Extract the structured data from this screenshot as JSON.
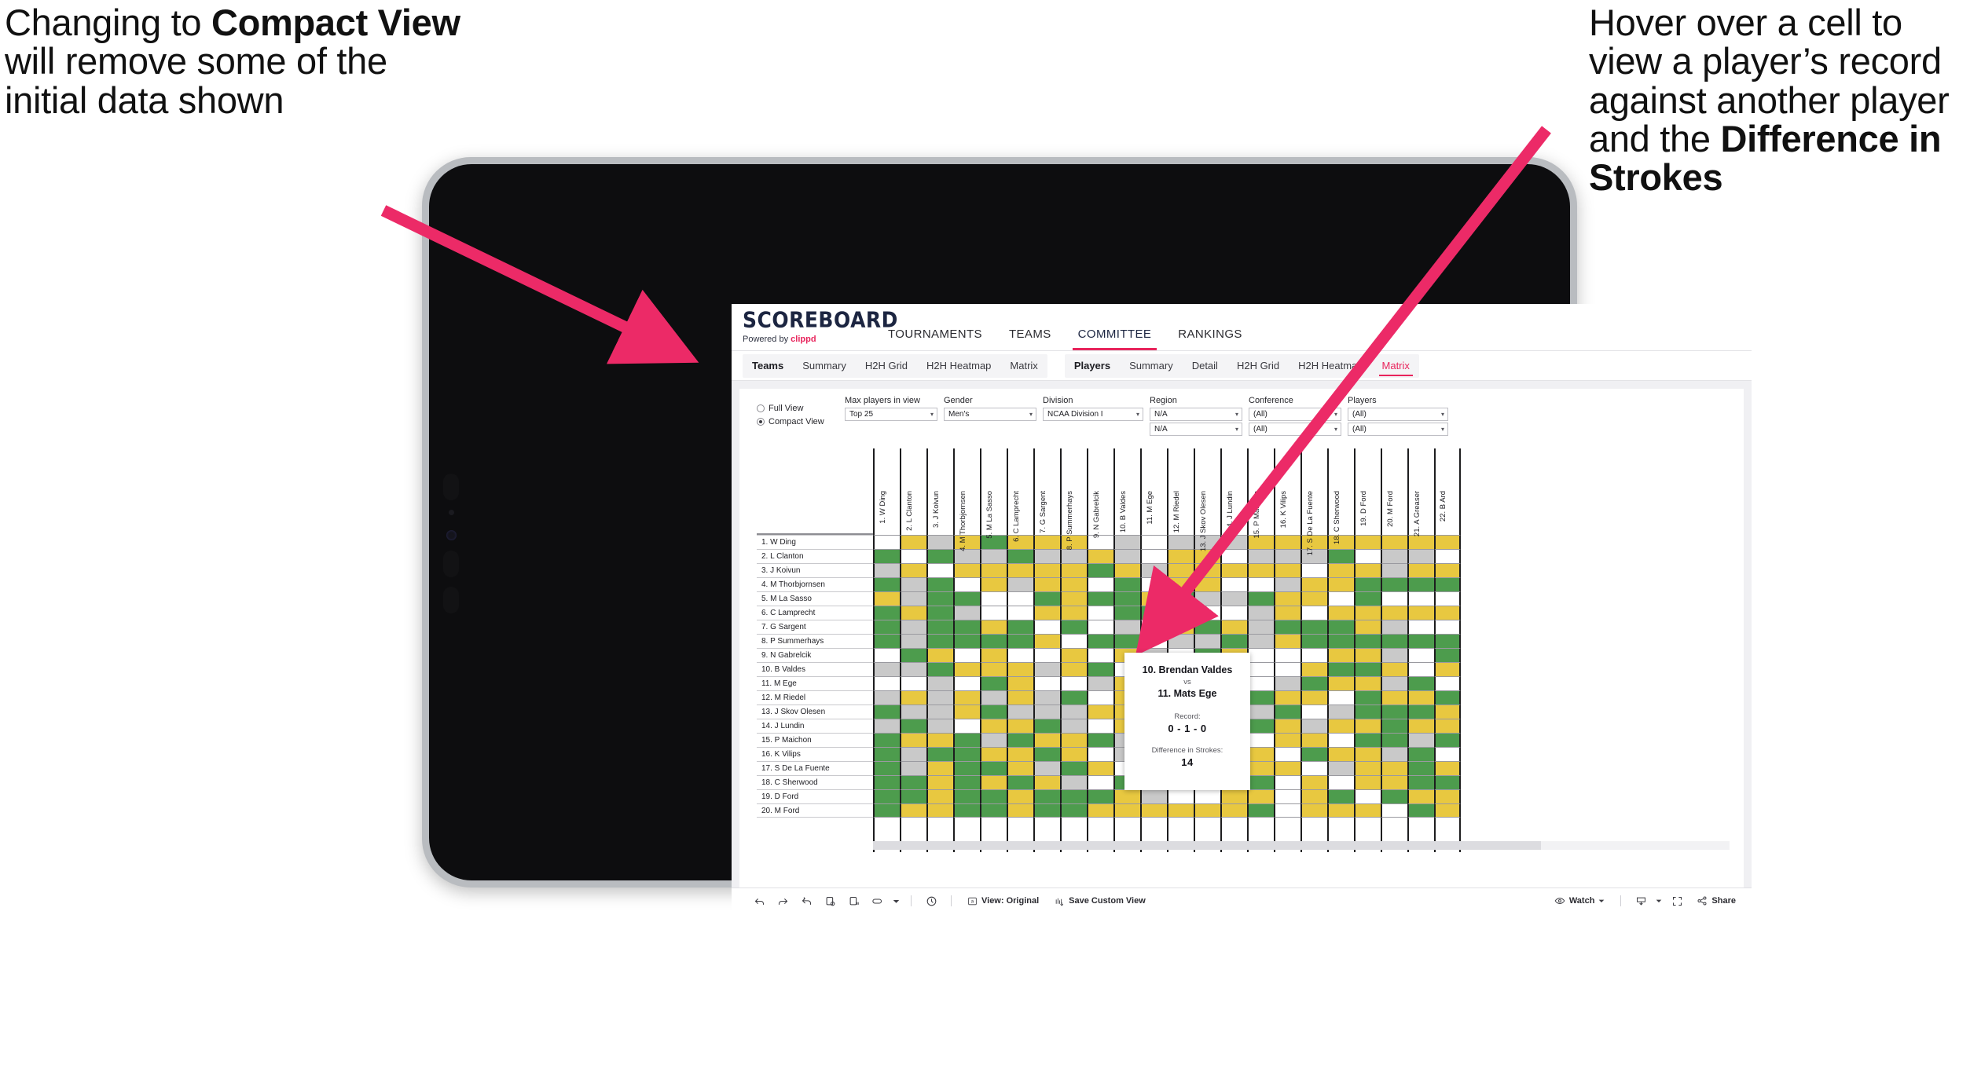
{
  "annotations": {
    "left": {
      "line1": "Changing to ",
      "bold": "Compact View",
      "line2": " will remove some of the initial data shown"
    },
    "right": {
      "line1": "Hover over a cell to view a player’s record against another player and the ",
      "bold": "Difference in Strokes"
    }
  },
  "accent_color": "#e8245c",
  "app": {
    "logo": {
      "word": "SCOREBOARD",
      "powered_prefix": "Powered by ",
      "brand": "clippd"
    },
    "top_nav": [
      {
        "label": "TOURNAMENTS",
        "active": false
      },
      {
        "label": "TEAMS",
        "active": false
      },
      {
        "label": "COMMITTEE",
        "active": true
      },
      {
        "label": "RANKINGS",
        "active": false
      }
    ],
    "sub_nav": {
      "teams_group": {
        "head": "Teams",
        "items": [
          "Summary",
          "H2H Grid",
          "H2H Heatmap",
          "Matrix"
        ]
      },
      "players_group": {
        "head": "Players",
        "items": [
          "Summary",
          "Detail",
          "H2H Grid",
          "H2H Heatmap",
          "Matrix"
        ],
        "active": "Matrix"
      }
    }
  },
  "filters": {
    "view_mode": {
      "full_label": "Full View",
      "compact_label": "Compact View",
      "selected": "Compact View"
    },
    "max_players": {
      "label": "Max players in view",
      "value": "Top 25"
    },
    "gender": {
      "label": "Gender",
      "value": "Men's"
    },
    "division": {
      "label": "Division",
      "value": "NCAA Division I"
    },
    "region": {
      "label": "Region",
      "value": "N/A",
      "value2": "N/A"
    },
    "conference": {
      "label": "Conference",
      "value": "(All)",
      "value2": "(All)"
    },
    "players": {
      "label": "Players",
      "value": "(All)",
      "value2": "(All)"
    }
  },
  "matrix": {
    "columns": [
      "1. W Ding",
      "2. L Clanton",
      "3. J Koivun",
      "4. M Thorbjornsen",
      "5. M La Sasso",
      "6. C Lamprecht",
      "7. G Sargent",
      "8. P Summerhays",
      "9. N Gabrelcik",
      "10. B Valdes",
      "11. M Ege",
      "12. M Riedel",
      "13. J Skov Olesen",
      "14. J Lundin",
      "15. P Maichon",
      "16. K Vilips",
      "17. S De La Fuente",
      "18. C Sherwood",
      "19. D Ford",
      "20. M Ford",
      "21. A Greaser",
      "22. B Ard"
    ],
    "rows": [
      "1. W Ding",
      "2. L Clanton",
      "3. J Koivun",
      "4. M Thorbjornsen",
      "5. M La Sasso",
      "6. C Lamprecht",
      "7. G Sargent",
      "8. P Summerhays",
      "9. N Gabrelcik",
      "10. B Valdes",
      "11. M Ege",
      "12. M Riedel",
      "13. J Skov Olesen",
      "14. J Lundin",
      "15. P Maichon",
      "16. K Vilips",
      "17. S De La Fuente",
      "18. C Sherwood",
      "19. D Ford",
      "20. M Ford"
    ],
    "legend": {
      "green": "#4d9c4d",
      "yellow": "#e8c840",
      "gray": "#c9c9c9",
      "white": "#ffffff"
    },
    "cells": [
      [
        "w",
        "y",
        "a",
        "y",
        "g",
        "y",
        "y",
        "y",
        "w",
        "a",
        "w",
        "a",
        "a",
        "a",
        "y",
        "y",
        "y",
        "y",
        "y",
        "y",
        "y",
        "y"
      ],
      [
        "g",
        "w",
        "g",
        "a",
        "a",
        "g",
        "a",
        "a",
        "y",
        "a",
        "w",
        "y",
        "y",
        "w",
        "a",
        "a",
        "a",
        "g",
        "w",
        "a",
        "a",
        "w"
      ],
      [
        "a",
        "y",
        "w",
        "y",
        "y",
        "y",
        "y",
        "y",
        "g",
        "y",
        "a",
        "y",
        "y",
        "y",
        "y",
        "y",
        "w",
        "y",
        "y",
        "a",
        "y",
        "y"
      ],
      [
        "g",
        "a",
        "g",
        "w",
        "y",
        "a",
        "y",
        "y",
        "w",
        "g",
        "w",
        "y",
        "y",
        "w",
        "w",
        "a",
        "y",
        "y",
        "g",
        "g",
        "g",
        "g"
      ],
      [
        "y",
        "a",
        "g",
        "g",
        "w",
        "w",
        "g",
        "y",
        "g",
        "g",
        "y",
        "g",
        "a",
        "a",
        "g",
        "y",
        "y",
        "w",
        "g",
        "w",
        "w",
        "w"
      ],
      [
        "g",
        "y",
        "g",
        "a",
        "w",
        "w",
        "y",
        "y",
        "w",
        "g",
        "g",
        "y",
        "w",
        "w",
        "a",
        "y",
        "w",
        "y",
        "y",
        "y",
        "y",
        "y"
      ],
      [
        "g",
        "a",
        "g",
        "g",
        "y",
        "g",
        "w",
        "g",
        "w",
        "a",
        "w",
        "y",
        "g",
        "y",
        "a",
        "g",
        "g",
        "g",
        "y",
        "a",
        "w",
        "w"
      ],
      [
        "g",
        "a",
        "g",
        "g",
        "g",
        "g",
        "y",
        "w",
        "g",
        "g",
        "w",
        "a",
        "a",
        "g",
        "a",
        "y",
        "g",
        "g",
        "g",
        "g",
        "g",
        "g"
      ],
      [
        "w",
        "g",
        "y",
        "w",
        "y",
        "w",
        "w",
        "y",
        "w",
        "y",
        "a",
        "w",
        "g",
        "y",
        "w",
        "w",
        "w",
        "y",
        "y",
        "a",
        "w",
        "g"
      ],
      [
        "a",
        "a",
        "g",
        "y",
        "y",
        "y",
        "a",
        "y",
        "g",
        "w",
        "g",
        "a",
        "y",
        "y",
        "w",
        "w",
        "y",
        "g",
        "g",
        "y",
        "w",
        "y"
      ],
      [
        "w",
        "w",
        "a",
        "w",
        "g",
        "y",
        "w",
        "w",
        "a",
        "y",
        "w",
        "w",
        "y",
        "w",
        "w",
        "a",
        "g",
        "y",
        "y",
        "a",
        "g",
        "w"
      ],
      [
        "a",
        "y",
        "a",
        "y",
        "a",
        "y",
        "a",
        "g",
        "w",
        "y",
        "w",
        "w",
        "y",
        "w",
        "g",
        "y",
        "y",
        "w",
        "g",
        "y",
        "y",
        "g"
      ],
      [
        "g",
        "a",
        "a",
        "y",
        "g",
        "a",
        "a",
        "a",
        "y",
        "y",
        "y",
        "a",
        "w",
        "y",
        "a",
        "g",
        "w",
        "a",
        "g",
        "g",
        "g",
        "y"
      ],
      [
        "a",
        "g",
        "a",
        "w",
        "y",
        "y",
        "g",
        "a",
        "w",
        "y",
        "y",
        "w",
        "y",
        "w",
        "g",
        "y",
        "a",
        "y",
        "y",
        "g",
        "y",
        "y"
      ],
      [
        "g",
        "y",
        "y",
        "g",
        "a",
        "g",
        "y",
        "y",
        "g",
        "a",
        "y",
        "g",
        "y",
        "a",
        "w",
        "y",
        "y",
        "w",
        "g",
        "g",
        "a",
        "g"
      ],
      [
        "g",
        "a",
        "g",
        "g",
        "y",
        "y",
        "g",
        "y",
        "w",
        "a",
        "g",
        "y",
        "w",
        "y",
        "y",
        "w",
        "g",
        "y",
        "y",
        "a",
        "g",
        "w"
      ],
      [
        "g",
        "a",
        "y",
        "g",
        "g",
        "y",
        "a",
        "g",
        "y",
        "w",
        "y",
        "w",
        "g",
        "y",
        "y",
        "y",
        "w",
        "a",
        "y",
        "y",
        "g",
        "y"
      ],
      [
        "g",
        "g",
        "y",
        "g",
        "y",
        "g",
        "y",
        "a",
        "w",
        "g",
        "y",
        "g",
        "w",
        "y",
        "g",
        "w",
        "y",
        "w",
        "y",
        "y",
        "g",
        "g"
      ],
      [
        "g",
        "g",
        "y",
        "g",
        "g",
        "y",
        "g",
        "g",
        "g",
        "y",
        "a",
        "w",
        "w",
        "y",
        "y",
        "w",
        "y",
        "g",
        "w",
        "g",
        "y",
        "y"
      ],
      [
        "g",
        "y",
        "y",
        "g",
        "g",
        "y",
        "g",
        "g",
        "y",
        "y",
        "y",
        "y",
        "y",
        "y",
        "g",
        "w",
        "y",
        "y",
        "y",
        "w",
        "g",
        "y"
      ]
    ]
  },
  "tooltip": {
    "player_a": "10. Brendan Valdes",
    "vs": "vs",
    "player_b": "11. Mats Ege",
    "record_label": "Record:",
    "record_value": "0 - 1 - 0",
    "strokes_label": "Difference in Strokes:",
    "strokes_value": "14"
  },
  "toolbar": {
    "icons": [
      "undo-icon",
      "redo-icon",
      "revert-icon",
      "refresh-icon",
      "pause-icon",
      "highlight-icon",
      "dropdown-caret-icon",
      "clock-icon"
    ],
    "view_original": "View: Original",
    "save_custom_view": "Save Custom View",
    "watch": "Watch",
    "share": "Share"
  }
}
